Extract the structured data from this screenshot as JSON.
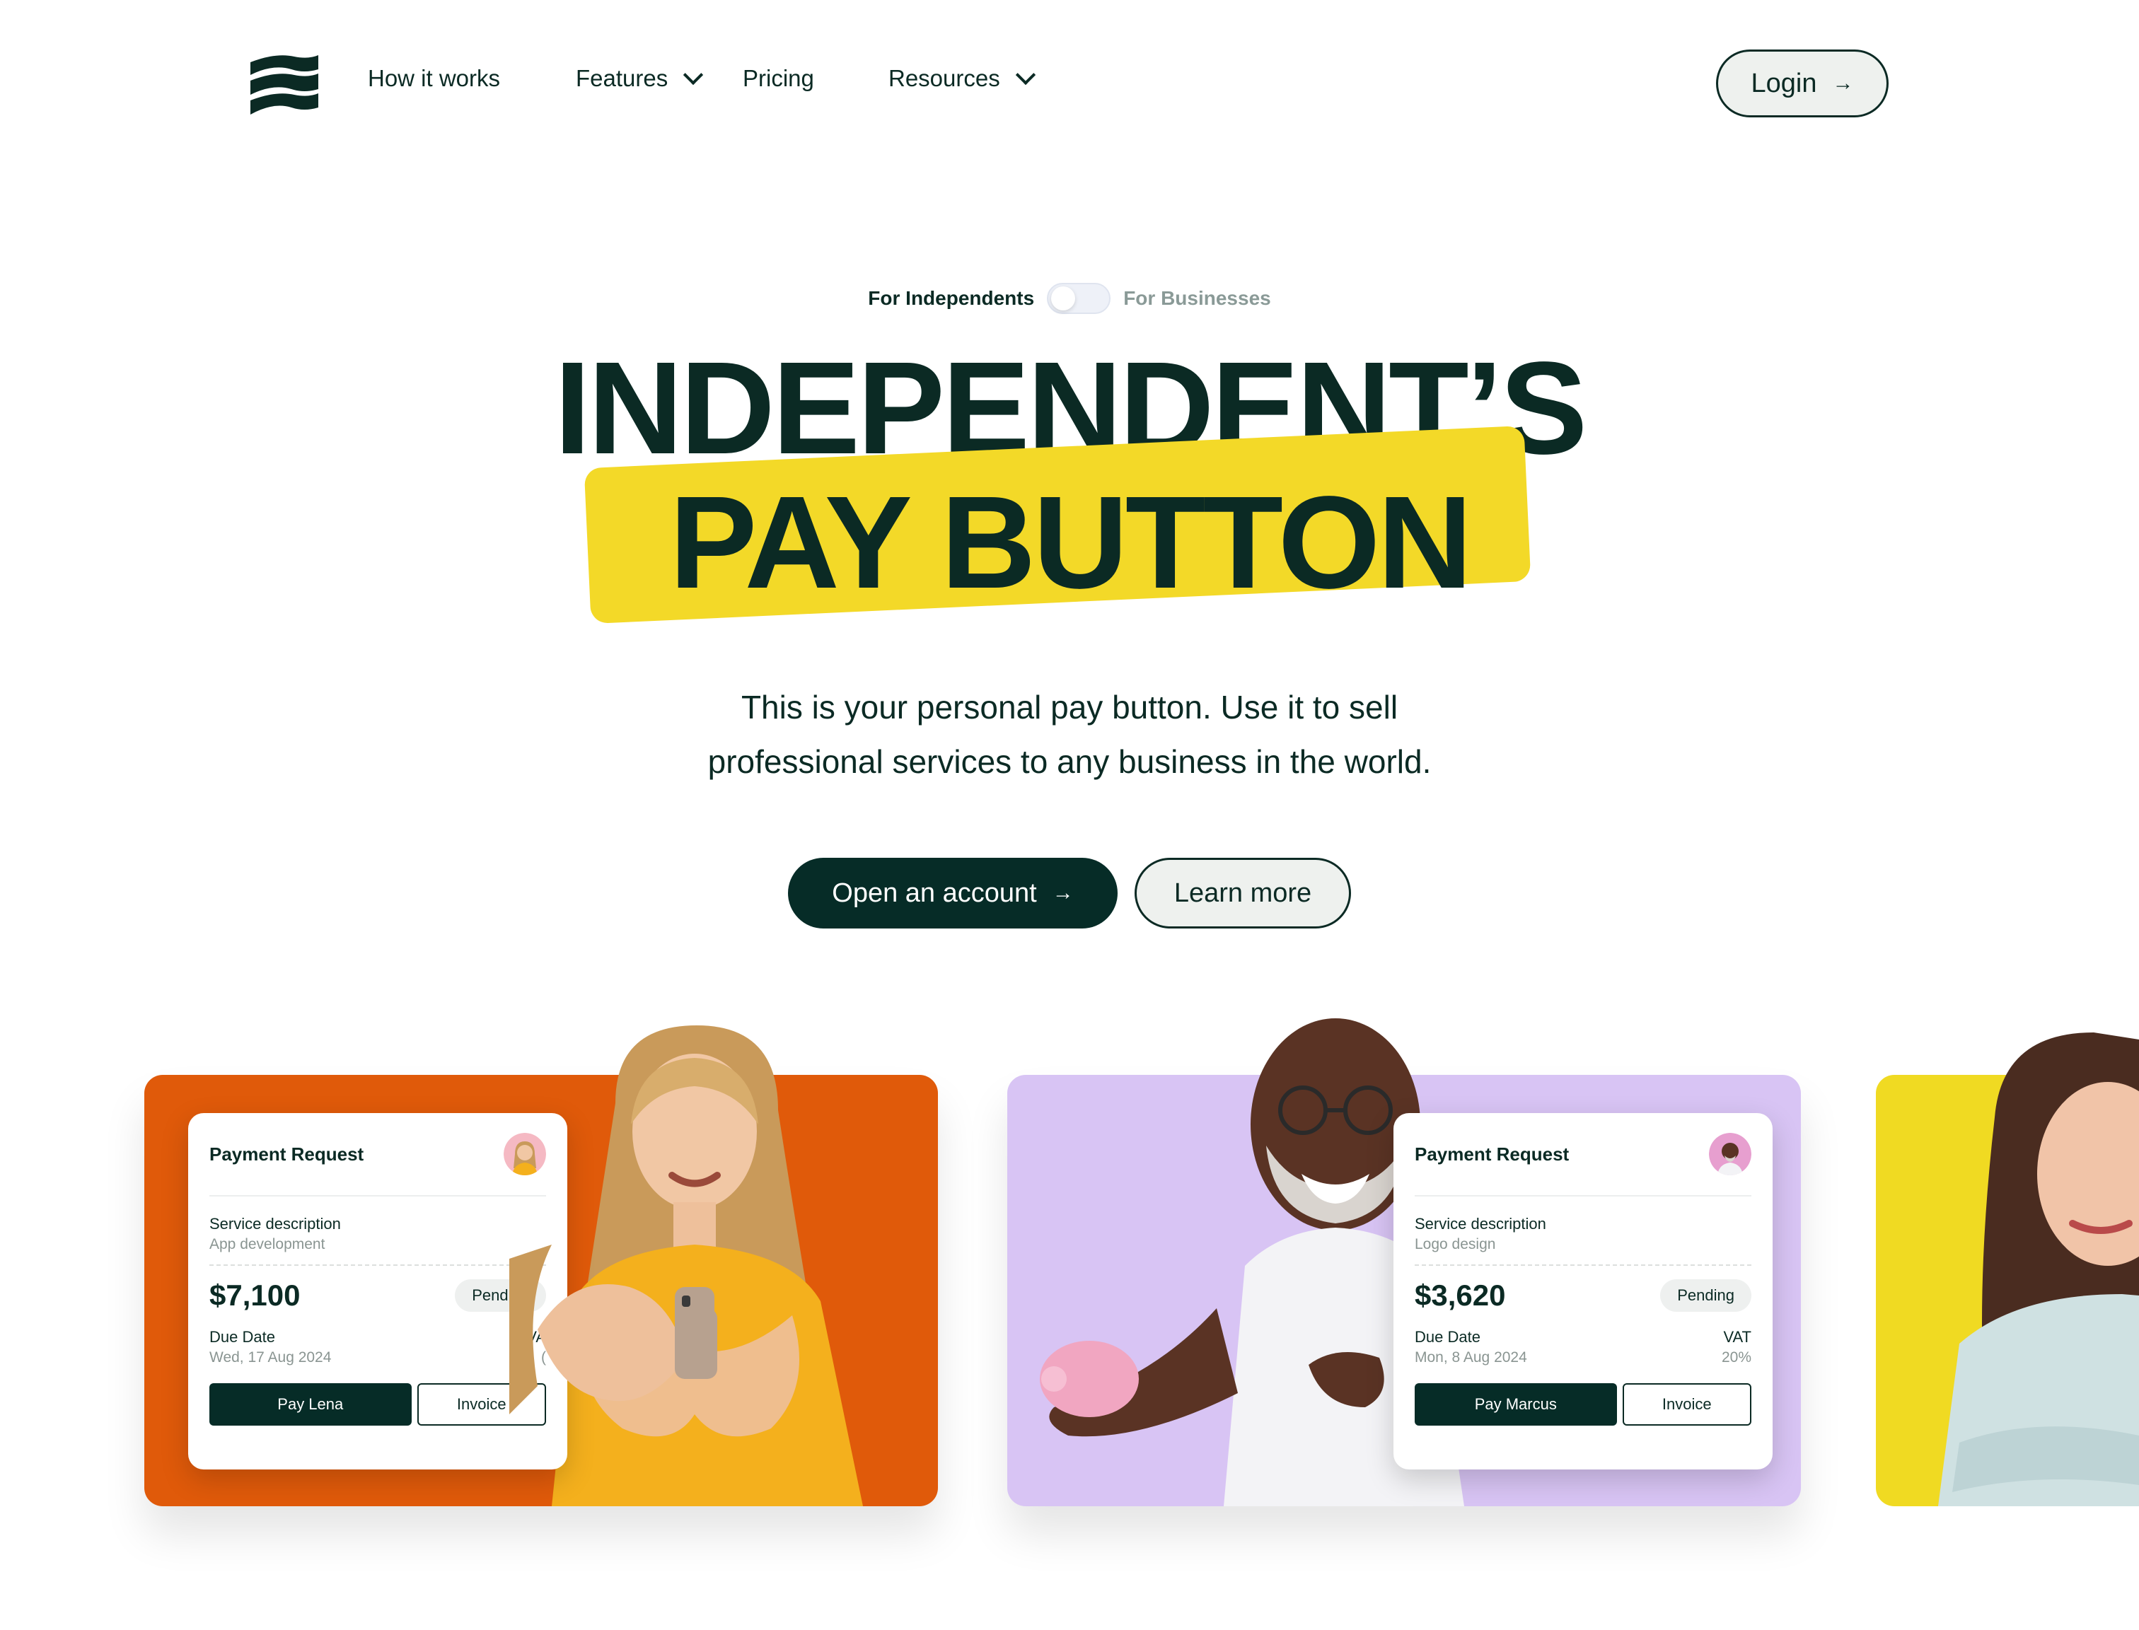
{
  "nav": {
    "logo_icon": "stripes-logo-icon",
    "items": [
      {
        "label": "How it works",
        "has_dropdown": false
      },
      {
        "label": "Features",
        "has_dropdown": true
      },
      {
        "label": "Pricing",
        "has_dropdown": false
      },
      {
        "label": "Resources",
        "has_dropdown": true
      }
    ],
    "login_label": "Login",
    "arrow": "→"
  },
  "toggle": {
    "left_label": "For Independents",
    "right_label": "For Businesses",
    "active": "left"
  },
  "hero": {
    "line1": "INDEPENDENT’S",
    "line2": "PAY BUTTON",
    "subtext_line1": "This is your personal pay button. Use it to sell",
    "subtext_line2": "professional services to any business in the world.",
    "primary_cta": "Open an account",
    "secondary_cta": "Learn more",
    "arrow": "→"
  },
  "cards": [
    {
      "title": "Payment Request",
      "service_label": "Service description",
      "service_value": "App development",
      "amount": "$7,100",
      "status": "Pending",
      "due_label": "Due Date",
      "due_value": "Wed, 17 Aug 2024",
      "vat_label": "VA",
      "vat_value": "(",
      "pay_label": "Pay Lena",
      "invoice_label": "Invoice"
    },
    {
      "title": "Payment Request",
      "service_label": "Service description",
      "service_value": "Logo design",
      "amount": "$3,620",
      "status": "Pending",
      "due_label": "Due Date",
      "due_value": "Mon, 8 Aug 2024",
      "vat_label": "VAT",
      "vat_value": "20%",
      "pay_label": "Pay Marcus",
      "invoice_label": "Invoice"
    }
  ],
  "colors": {
    "brand_dark": "#062c27",
    "highlight_yellow": "#f3d928",
    "panel_orange": "#e05a0a",
    "panel_purple": "#d8c4f4",
    "panel_yellow": "#f0da22"
  }
}
